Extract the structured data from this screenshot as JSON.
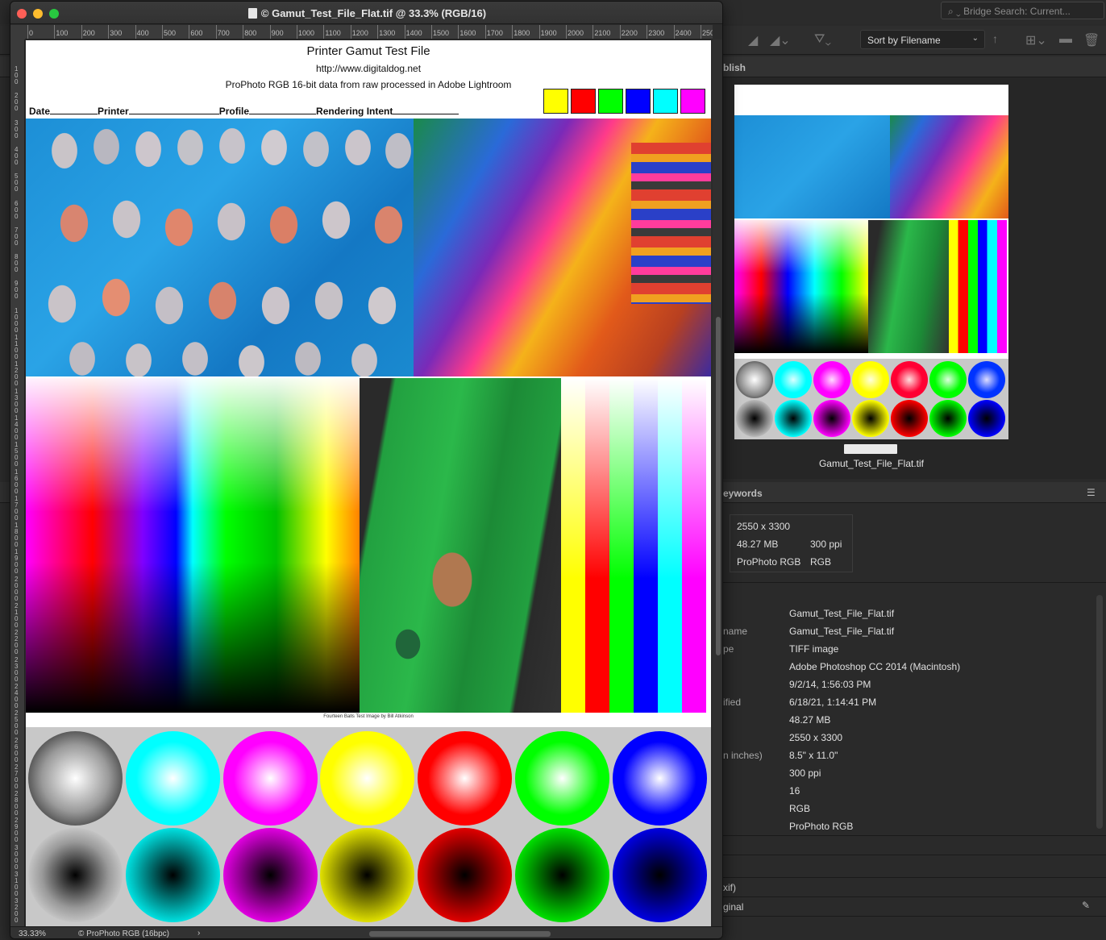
{
  "bridge": {
    "search_placeholder": "Bridge Search: Current...",
    "sort_label": "Sort by Filename",
    "panel_publish": "blish",
    "panel_keywords": "eywords",
    "thumbnail_label": "Gamut_Test_File_Flat.tif",
    "summary": {
      "dimensions": "2550 x 3300",
      "size": "48.27 MB",
      "resolution": "300 ppi",
      "profile": "ProPhoto RGB",
      "mode": "RGB"
    },
    "metadata_labels": [
      "name",
      "pe",
      "ified",
      "n inches)"
    ],
    "metadata_values": [
      "Gamut_Test_File_Flat.tif",
      "Gamut_Test_File_Flat.tif",
      "TIFF image",
      "Adobe Photoshop CC 2014 (Macintosh)",
      "9/2/14, 1:56:03 PM",
      "6/18/21, 1:14:41 PM",
      "48.27 MB",
      "2550 x 3300",
      "8.5\" x 11.0\"",
      "300 ppi",
      "16",
      "RGB",
      "ProPhoto RGB"
    ],
    "section_exif": "xif)",
    "section_original": "ginal"
  },
  "photoshop": {
    "window_title": "© Gamut_Test_File_Flat.tif @ 33.3% (RGB/16)",
    "ruler_h": [
      "0",
      "100",
      "200",
      "300",
      "400",
      "500",
      "600",
      "700",
      "800",
      "900",
      "1000",
      "1100",
      "1200",
      "1300",
      "1400",
      "1500",
      "1600",
      "1700",
      "1800",
      "1900",
      "2000",
      "2100",
      "2200",
      "2300",
      "2400",
      "250"
    ],
    "ruler_v": [
      "100",
      "200",
      "300",
      "400",
      "500",
      "600",
      "700",
      "800",
      "900",
      "1000",
      "1100",
      "1200",
      "1300",
      "1400",
      "1500",
      "1600",
      "1700",
      "1800",
      "1900",
      "2000",
      "2100",
      "2200",
      "2300",
      "2400",
      "2500",
      "2600",
      "2700",
      "2800",
      "2900",
      "3000",
      "3100",
      "3200"
    ],
    "status_zoom": "33.33%",
    "status_profile": "© ProPhoto RGB (16bpc)",
    "status_arrow": "›"
  },
  "document": {
    "title": "Printer Gamut Test File",
    "url": "http://www.digitaldog.net",
    "subtitle": "ProPhoto RGB 16-bit data from raw processed in Adobe Lightroom",
    "field_date": "Date",
    "field_printer": "Printer",
    "field_profile": "Profile",
    "field_intent": "Rendering Intent",
    "swatch_colors": [
      "#ffff00",
      "#ff0000",
      "#00ff00",
      "#0000ff",
      "#00ffff",
      "#ff00ff"
    ],
    "stripe_colors": [
      "#ffff00",
      "#ff0000",
      "#00ff00",
      "#0000ff",
      "#00ffff",
      "#ff00ff"
    ],
    "caption": "Fourteen Balls Test Image by Bill Atkinson",
    "ball_colors": [
      "#888888",
      "#00ffff",
      "#ff00ff",
      "#ffff00",
      "#ff0000",
      "#00ff00",
      "#0000ff"
    ]
  }
}
